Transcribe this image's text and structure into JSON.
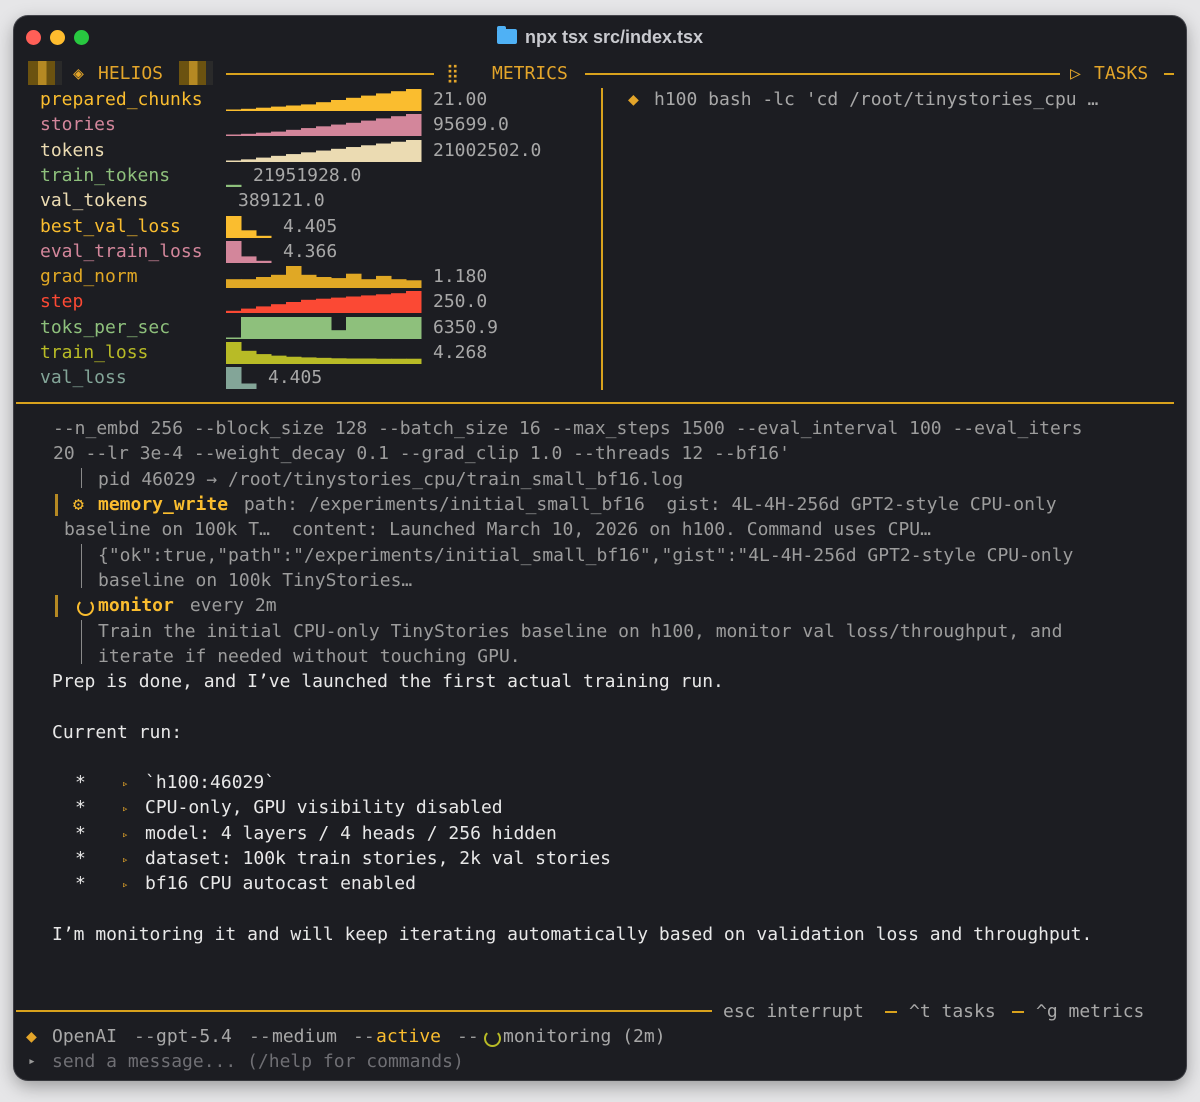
{
  "window": {
    "title": "npx tsx src/index.tsx"
  },
  "colors": {
    "accent": "#d9a21d",
    "background": "#1c1d22",
    "text": "#e8e8e8",
    "muted": "#9c9c9c"
  },
  "panels": {
    "brand": "HELIOS",
    "metrics_title": "METRICS",
    "tasks_title": "TASKS"
  },
  "metrics": [
    {
      "name": "prepared_chunks",
      "value": "21.00",
      "color": "#fabd2f",
      "spark": [
        0.05,
        0.1,
        0.15,
        0.2,
        0.25,
        0.3,
        0.4,
        0.5,
        0.6,
        0.7,
        0.8,
        0.9,
        1.0
      ]
    },
    {
      "name": "stories",
      "value": "95699.0",
      "color": "#d3869b",
      "spark": [
        0.05,
        0.1,
        0.15,
        0.2,
        0.28,
        0.36,
        0.44,
        0.52,
        0.6,
        0.7,
        0.8,
        0.9,
        1.0
      ]
    },
    {
      "name": "tokens",
      "value": "21002502.0",
      "color": "#ebdbb2",
      "spark": [
        0.05,
        0.12,
        0.2,
        0.28,
        0.36,
        0.44,
        0.52,
        0.6,
        0.68,
        0.76,
        0.84,
        0.92,
        1.0
      ]
    },
    {
      "name": "train_tokens",
      "value": "21951928.0",
      "color": "#8ec07c",
      "spark": [
        0.1
      ]
    },
    {
      "name": "val_tokens",
      "value": "389121.0",
      "color": "#ebdbb2",
      "spark": []
    },
    {
      "name": "best_val_loss",
      "value": "4.405",
      "color": "#fabd2f",
      "spark": [
        1.0,
        0.35,
        0.1
      ]
    },
    {
      "name": "eval_train_loss",
      "value": "4.366",
      "color": "#d3869b",
      "spark": [
        1.0,
        0.3,
        0.1
      ]
    },
    {
      "name": "grad_norm",
      "value": "1.180",
      "color": "#e0a825",
      "spark": [
        0.4,
        0.4,
        0.5,
        0.6,
        1.0,
        0.6,
        0.5,
        0.45,
        0.65,
        0.4,
        0.55,
        0.4,
        0.35
      ]
    },
    {
      "name": "step",
      "value": "250.0",
      "color": "#fb4934",
      "spark": [
        0.1,
        0.2,
        0.3,
        0.4,
        0.5,
        0.6,
        0.65,
        0.7,
        0.75,
        0.8,
        0.85,
        0.9,
        1.0
      ]
    },
    {
      "name": "toks_per_sec",
      "value": "6350.9",
      "color": "#8ec07c",
      "spark": [
        0.0,
        1.0,
        1.0,
        1.0,
        1.0,
        1.0,
        1.0,
        0.4,
        1.0,
        1.0,
        1.0,
        1.0,
        1.0
      ]
    },
    {
      "name": "train_loss",
      "value": "4.268",
      "color": "#b8bb26",
      "spark": [
        1.0,
        0.6,
        0.45,
        0.38,
        0.33,
        0.3,
        0.28,
        0.26,
        0.25,
        0.25,
        0.24,
        0.24,
        0.24
      ]
    },
    {
      "name": "val_loss",
      "value": "4.405",
      "color": "#83a598",
      "spark": [
        1.0,
        0.25
      ]
    }
  ],
  "tasks": [
    {
      "text": "h100 bash -lc 'cd /root/tinystories_cpu …"
    }
  ],
  "log": {
    "cmd_line1": "--n_embd 256 --block_size 128 --batch_size 16 --max_steps 1500 --eval_interval 100 --eval_iters",
    "cmd_line2": "20 --lr 3e-4 --weight_decay 0.1 --grad_clip 1.0 --threads 12 --bf16'",
    "pid_line": "pid 46029 → /root/tinystories_cpu/train_small_bf16.log",
    "tool1_name": "memory_write",
    "tool1_args1": " path: /experiments/initial_small_bf16  gist: 4L-4H-256d GPT2-style CPU-only",
    "tool1_args2": "baseline on 100k T…  content: Launched March 10, 2026 on h100. Command uses CPU…",
    "tool1_result1": "{\"ok\":true,\"path\":\"/experiments/initial_small_bf16\",\"gist\":\"4L-4H-256d GPT2-style CPU-only",
    "tool1_result2": "baseline on 100k TinyStories…",
    "tool2_name": "monitor",
    "tool2_args": " every 2m",
    "tool2_result1": "Train the initial CPU-only TinyStories baseline on h100, monitor val loss/throughput, and",
    "tool2_result2": "iterate if needed without touching GPU."
  },
  "message": {
    "intro": "Prep is done, and I’ve launched the first actual training run.",
    "heading": "Current run:",
    "bullets": [
      "`h100:46029`",
      "CPU-only, GPU visibility disabled",
      "model: 4 layers / 4 heads / 256 hidden",
      "dataset: 100k train stories, 2k val stories",
      "bf16 CPU autocast enabled"
    ],
    "outro": "I’m monitoring it and will keep iterating automatically based on validation loss and throughput."
  },
  "hints": {
    "interrupt": "esc interrupt",
    "tasks": "^t tasks",
    "metrics": "^g metrics"
  },
  "status": {
    "provider": "OpenAI",
    "model": "gpt-5.4",
    "effort": "medium",
    "state": "active",
    "activity": "monitoring (2m)"
  },
  "input": {
    "placeholder": "send a message... (/help for commands)"
  }
}
